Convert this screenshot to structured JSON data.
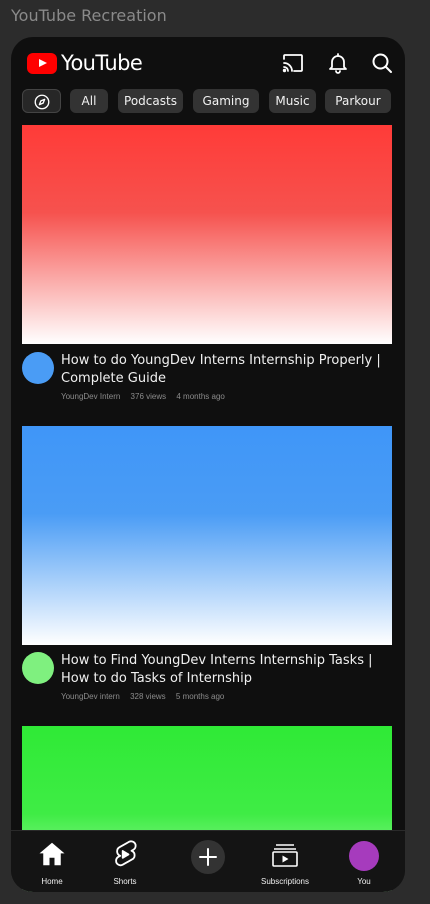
{
  "frame_title": "YouTube Recreation",
  "header": {
    "brand": "YouTube",
    "icons": [
      "cast-icon",
      "bell-icon",
      "search-icon"
    ]
  },
  "chips": [
    {
      "label": "",
      "icon": "compass-icon"
    },
    {
      "label": "All"
    },
    {
      "label": "Podcasts"
    },
    {
      "label": "Gaming"
    },
    {
      "label": "Music"
    },
    {
      "label": "Parkour"
    }
  ],
  "videos": [
    {
      "thumbnail_color": "#ff3b38",
      "avatar_color": "#4a9cf5",
      "title": "How to do YoungDev Interns Internship Properly | Complete Guide",
      "channel": "YoungDev Intern",
      "views": "376 views",
      "age": "4 months ago"
    },
    {
      "thumbnail_color": "#3f96f8",
      "avatar_color": "#7ff07f",
      "title": "How to Find YoungDev Interns Internship Tasks | How to do Tasks of Internship",
      "channel": "YoungDev intern",
      "views": "328 views",
      "age": "5 months ago"
    },
    {
      "thumbnail_color": "#2fea36"
    }
  ],
  "bottom_nav": [
    {
      "label": "Home",
      "icon": "home-icon"
    },
    {
      "label": "Shorts",
      "icon": "shorts-icon"
    },
    {
      "label": "",
      "icon": "create-icon"
    },
    {
      "label": "Subscriptions",
      "icon": "subscriptions-icon"
    },
    {
      "label": "You",
      "icon": "profile-avatar",
      "color": "#a63bbd"
    }
  ]
}
